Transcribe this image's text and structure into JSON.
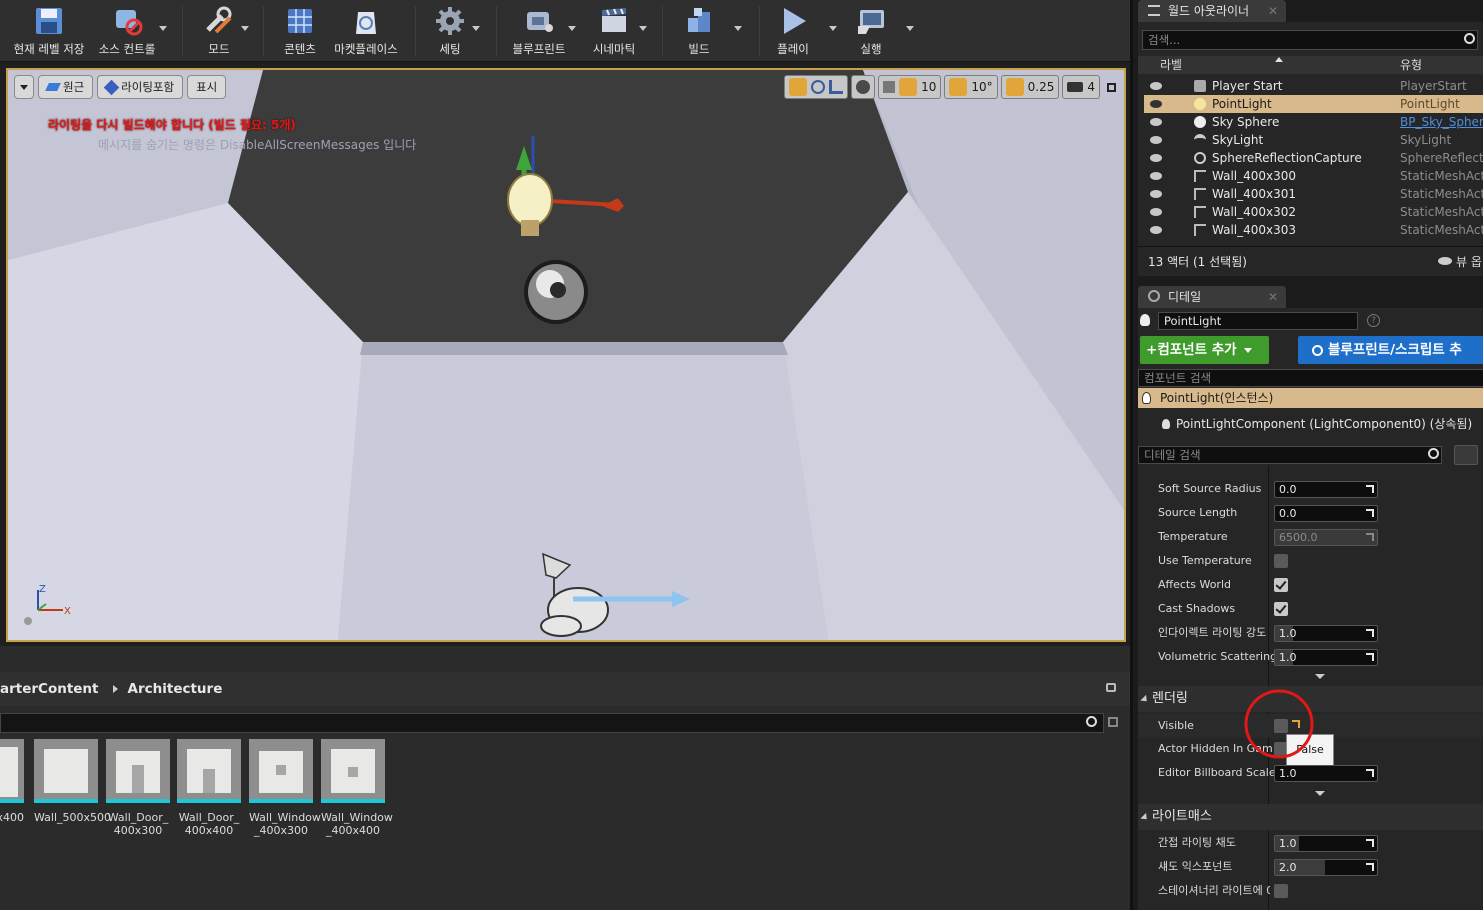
{
  "toolbar": {
    "save": "현재 레벨 저장",
    "source_control": "소스 컨트롤",
    "modes": "모드",
    "content": "콘텐츠",
    "marketplace": "마켓플레이스",
    "settings": "세팅",
    "blueprints": "블루프린트",
    "cinematics": "시네마틱",
    "build": "빌드",
    "play": "플레이",
    "launch": "실행"
  },
  "viewport": {
    "perspective": "원근",
    "lit": "라이팅포함",
    "show": "표시",
    "grid_snap": "10",
    "rot_snap": "10°",
    "scale_snap": "0.25",
    "camera_speed": "4",
    "warning": "라이팅을 다시 빌드해야 합니다 (빌드 필요: 5개)",
    "hint": "메시지를 숨기는 명령은 DisableAllScreenMessages 입니다",
    "axis_z": "Z",
    "axis_x": "X"
  },
  "content_browser": {
    "path_root": "arterContent",
    "path_leaf": "Architecture",
    "assets": [
      {
        "label": "0x400"
      },
      {
        "label": "Wall_500x500"
      },
      {
        "label": "Wall_Door_ 400x300"
      },
      {
        "label": "Wall_Door_ 400x400"
      },
      {
        "label": "Wall_Window _400x300"
      },
      {
        "label": "Wall_Window _400x400"
      }
    ]
  },
  "outliner": {
    "tab": "월드 아웃라이너",
    "search_placeholder": "검색...",
    "col_label": "라벨",
    "col_type": "유형",
    "rows": [
      {
        "name": "Player Start",
        "type": "PlayerStart"
      },
      {
        "name": "PointLight",
        "type": "PointLight"
      },
      {
        "name": "Sky Sphere",
        "type": "BP_Sky_Sphere"
      },
      {
        "name": "SkyLight",
        "type": "SkyLight"
      },
      {
        "name": "SphereReflectionCapture",
        "type": "SphereReflection"
      },
      {
        "name": "Wall_400x300",
        "type": "StaticMeshActor"
      },
      {
        "name": "Wall_400x301",
        "type": "StaticMeshActor"
      },
      {
        "name": "Wall_400x302",
        "type": "StaticMeshActor"
      },
      {
        "name": "Wall_400x303",
        "type": "StaticMeshActor"
      }
    ],
    "count": "13 액터 (1 선택됨)",
    "view_options": "뷰 옵"
  },
  "details": {
    "tab": "디테일",
    "actor_name": "PointLight",
    "add_component": "컴포넌트 추가",
    "blueprint": "블루프린트/스크립트 추",
    "component_search": "컴포넌트 검색",
    "instance": "PointLight(인스턴스)",
    "component": "PointLightComponent (LightComponent0) (상속됨)",
    "detail_search": "디테일 검색",
    "props": {
      "soft_source_radius": {
        "label": "Soft Source Radius",
        "value": "0.0"
      },
      "source_length": {
        "label": "Source Length",
        "value": "0.0"
      },
      "temperature": {
        "label": "Temperature",
        "value": "6500.0"
      },
      "use_temperature": {
        "label": "Use Temperature"
      },
      "affects_world": {
        "label": "Affects World"
      },
      "cast_shadows": {
        "label": "Cast Shadows"
      },
      "indirect_intensity": {
        "label": "인다이렉트 라이팅 강도",
        "value": "1.0"
      },
      "volumetric_scattering": {
        "label": "Volumetric Scattering",
        "value": "1.0"
      }
    },
    "rendering": {
      "title": "렌더링",
      "visible": "Visible",
      "actor_hidden": "Actor Hidden In Gam",
      "tooltip": "False",
      "billboard": "Editor Billboard Scale",
      "billboard_value": "1.0"
    },
    "lightmass": {
      "title": "라이트매스",
      "indirect_saturation": "간접 라이팅 채도",
      "indirect_saturation_value": "1.0",
      "shadow_exponent": "섀도 익스포넌트",
      "shadow_exponent_value": "2.0",
      "stationary": "스테이셔너리 라이트에 0"
    }
  },
  "colors": {
    "accent": "#e1a53a",
    "selection": "#d8b98c",
    "warning": "#e01818",
    "add_component": "#3e9b2c",
    "blueprint": "#1e6fc9",
    "cyan": "#1fc7d6"
  }
}
